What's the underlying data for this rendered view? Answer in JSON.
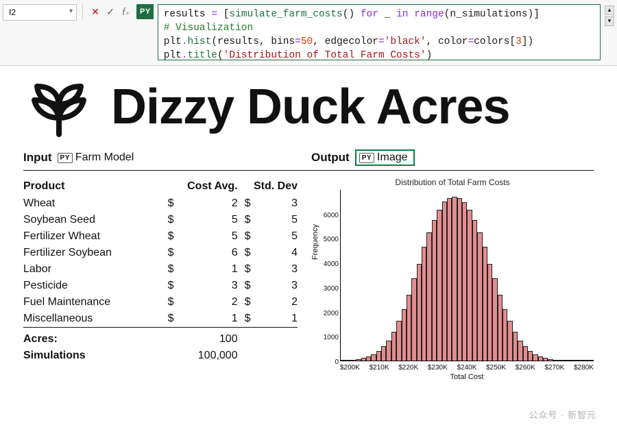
{
  "cell_ref": "I2",
  "py_badge": "PY",
  "code": {
    "line1_a": "results ",
    "line1_eq": "= ",
    "line1_b": "[",
    "line1_fn": "simulate_farm_costs",
    "line1_c": "() ",
    "line1_for": "for",
    "line1_d": " _ ",
    "line1_in": "in",
    "line1_e": " ",
    "line1_range": "range",
    "line1_f": "(n_simulations)]",
    "line2": "# Visualization",
    "line3_a": "plt",
    "line3_dot1": ".",
    "line3_hist": "hist",
    "line3_b": "(results, bins",
    "line3_eq1": "=",
    "line3_num50": "50",
    "line3_c": ", edgecolor",
    "line3_eq2": "=",
    "line3_str1": "'black'",
    "line3_d": ", color",
    "line3_eq3": "=",
    "line3_e": "colors[",
    "line3_num3": "3",
    "line3_f": "])",
    "line4_a": "plt",
    "line4_dot": ".",
    "line4_title": "title",
    "line4_b": "(",
    "line4_str": "'Distribution of Total Farm Costs'",
    "line4_c": ")"
  },
  "brand_title": "Dizzy Duck Acres",
  "io": {
    "input_label": "Input",
    "input_tag": "PY",
    "input_text": "Farm Model",
    "output_label": "Output",
    "output_tag": "PY",
    "output_text": "Image"
  },
  "table": {
    "h_product": "Product",
    "h_cost": "Cost Avg.",
    "h_std": "Std. Dev",
    "currency": "$",
    "rows": [
      {
        "name": "Wheat",
        "cost": "2",
        "std": "3"
      },
      {
        "name": "Soybean Seed",
        "cost": "5",
        "std": "5"
      },
      {
        "name": "Fertilizer Wheat",
        "cost": "5",
        "std": "5"
      },
      {
        "name": "Fertilizer Soybean",
        "cost": "6",
        "std": "4"
      },
      {
        "name": "Labor",
        "cost": "1",
        "std": "3"
      },
      {
        "name": "Pesticide",
        "cost": "3",
        "std": "3"
      },
      {
        "name": "Fuel Maintenance",
        "cost": "2",
        "std": "2"
      },
      {
        "name": "Miscellaneous",
        "cost": "1",
        "std": "1"
      }
    ],
    "acres_label": "Acres:",
    "acres_value": "100",
    "sim_label": "Simulations",
    "sim_value": "100,000"
  },
  "chart_data": {
    "type": "bar",
    "title": "Distribution of Total Farm Costs",
    "xlabel": "Total Cost",
    "ylabel": "Frequency",
    "ylim": [
      0,
      7000
    ],
    "yticks": [
      "0",
      "1000",
      "2000",
      "3000",
      "4000",
      "5000",
      "6000"
    ],
    "categories": [
      "$200K",
      "$210K",
      "$220K",
      "$230K",
      "$240K",
      "$250K",
      "$260K",
      "$270K",
      "$280K"
    ],
    "values": [
      5,
      15,
      30,
      55,
      100,
      160,
      260,
      400,
      600,
      820,
      1180,
      1620,
      2100,
      2700,
      3350,
      3950,
      4650,
      5250,
      5750,
      6150,
      6500,
      6650,
      6700,
      6650,
      6480,
      6150,
      5750,
      5250,
      4650,
      3950,
      3350,
      2700,
      2100,
      1620,
      1180,
      820,
      600,
      400,
      260,
      160,
      100,
      55,
      30,
      18,
      12,
      8,
      5,
      3,
      2,
      1
    ]
  },
  "watermark": "公众号 · 新智元"
}
